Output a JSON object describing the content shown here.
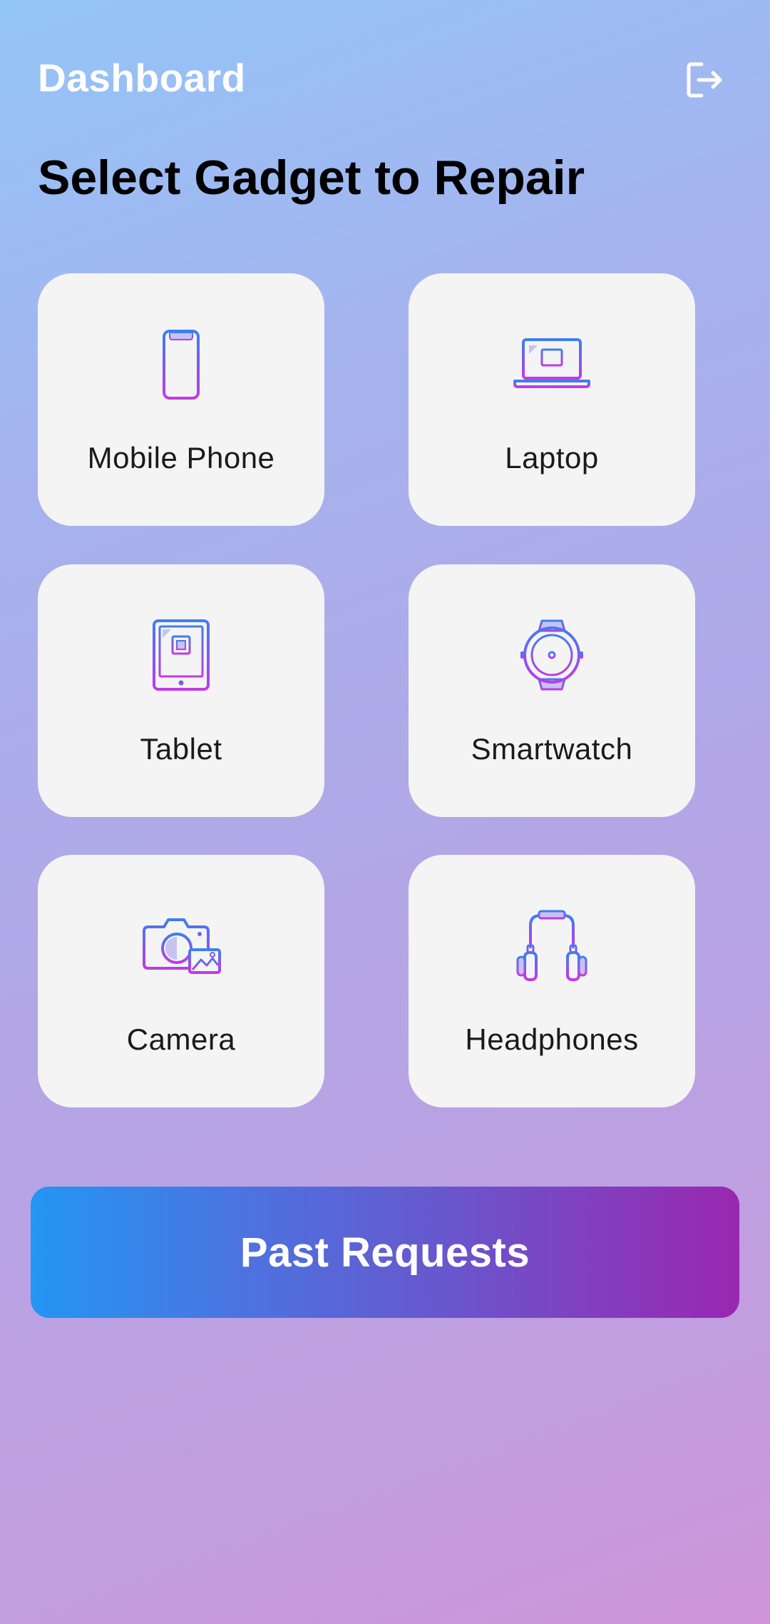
{
  "header": {
    "title": "Dashboard",
    "logout_icon": "logout-icon"
  },
  "section_title": "Select Gadget to Repair",
  "gadgets": [
    {
      "label": "Mobile Phone",
      "icon": "mobile-phone-icon"
    },
    {
      "label": "Laptop",
      "icon": "laptop-icon"
    },
    {
      "label": "Tablet",
      "icon": "tablet-icon"
    },
    {
      "label": "Smartwatch",
      "icon": "smartwatch-icon"
    },
    {
      "label": "Camera",
      "icon": "camera-icon"
    },
    {
      "label": "Headphones",
      "icon": "headphones-icon"
    }
  ],
  "past_requests_button": {
    "label": "Past Requests"
  },
  "colors": {
    "icon_gradient_start": "#3f7ef0",
    "icon_gradient_end": "#c03ae6",
    "button_gradient_start": "#2396f3",
    "button_gradient_end": "#9a27b0",
    "card_bg": "#f4f4f4"
  }
}
